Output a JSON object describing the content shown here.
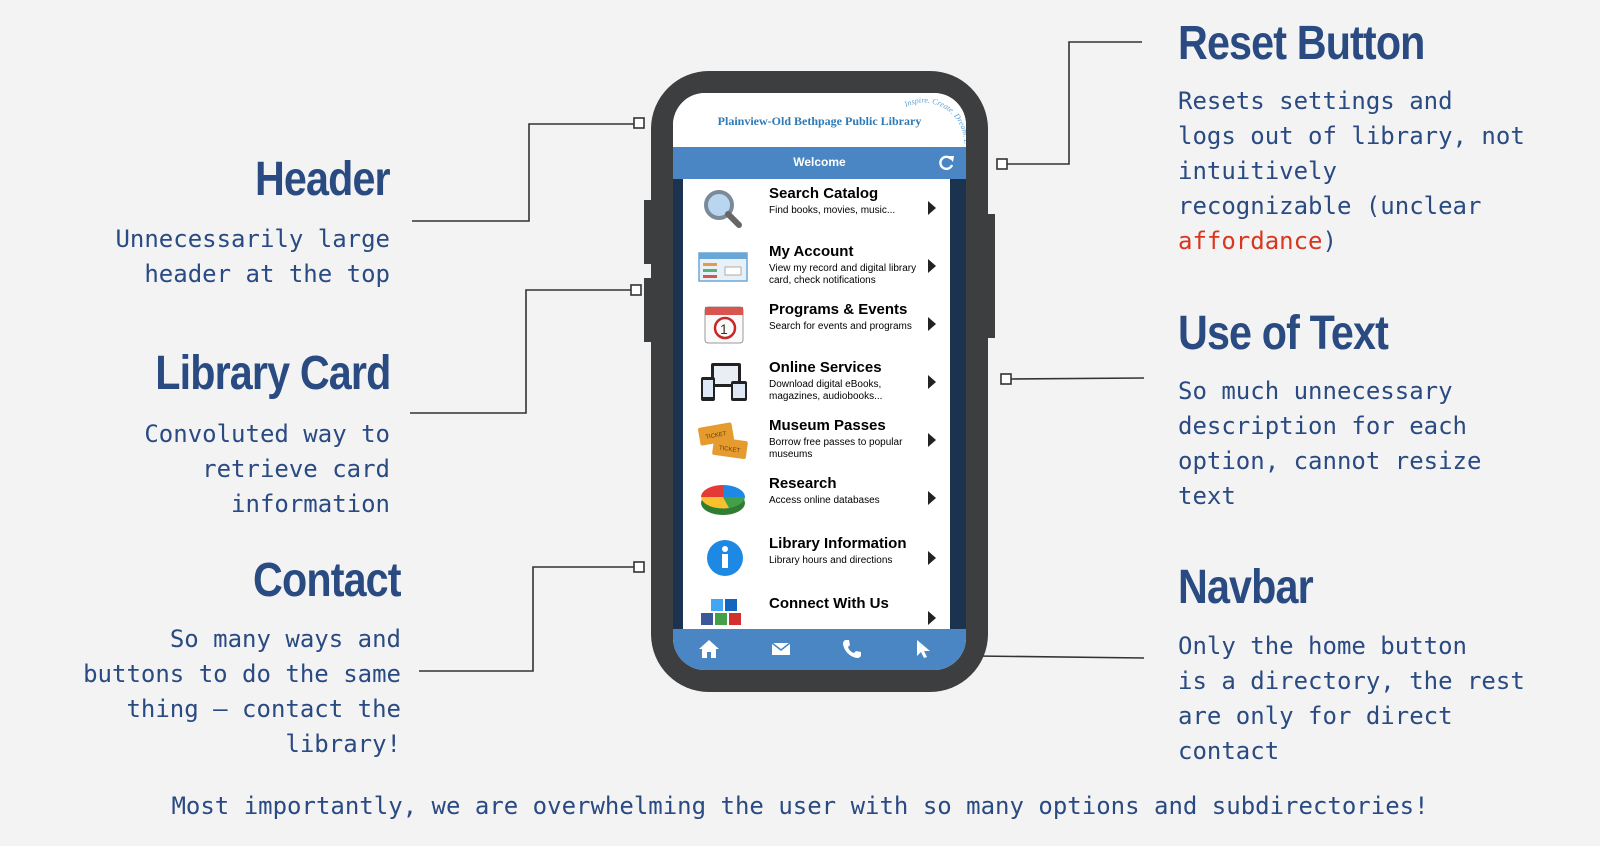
{
  "annotations": {
    "header": {
      "title": "Header",
      "desc_lines": [
        "Unnecessarily large",
        "header at the top"
      ]
    },
    "library_card": {
      "title": "Library Card",
      "desc_lines": [
        "Convoluted way to",
        "retrieve card",
        "information"
      ]
    },
    "contact": {
      "title": "Contact",
      "desc_lines": [
        "So many ways and",
        "buttons to do the same",
        "thing — contact the",
        "library!"
      ]
    },
    "reset_button": {
      "title": "Reset Button",
      "desc_lines": [
        "Resets settings and",
        "logs out of library, not",
        "intuitively",
        "recognizable (unclear"
      ],
      "desc_highlight": "affordance",
      "desc_end": ")"
    },
    "use_of_text": {
      "title": "Use of Text",
      "desc_lines": [
        "So much unnecessary",
        "description for each",
        "option, cannot resize",
        "text"
      ]
    },
    "navbar": {
      "title": "Navbar",
      "desc_lines": [
        "Only the home button",
        "is a directory, the rest",
        "are only for direct",
        "contact"
      ]
    }
  },
  "footer": "Most importantly, we are overwhelming the user with so many options and subdirectories!",
  "phone": {
    "header_title": "Plainview-Old Bethpage Public Library",
    "header_tagline": "Inspire. Create. Dream. Learn.",
    "welcome": "Welcome",
    "menu": [
      {
        "title": "Search Catalog",
        "subtitle": "Find books, movies, music...",
        "icon": "magnifier-icon"
      },
      {
        "title": "My Account",
        "subtitle": "View my record and digital library card, check notifications",
        "icon": "library-card-icon"
      },
      {
        "title": "Programs & Events",
        "subtitle": "Search for events and programs",
        "icon": "calendar-icon"
      },
      {
        "title": "Online Services",
        "subtitle": "Download digital eBooks, magazines, audiobooks...",
        "icon": "devices-icon"
      },
      {
        "title": "Museum Passes",
        "subtitle": "Borrow free passes to popular museums",
        "icon": "ticket-icon"
      },
      {
        "title": "Research",
        "subtitle": "Access online databases",
        "icon": "pie-chart-icon"
      },
      {
        "title": "Library Information",
        "subtitle": "Library hours and directions",
        "icon": "info-icon"
      },
      {
        "title": "Connect With Us",
        "subtitle": "",
        "icon": "social-icons"
      }
    ],
    "navbar": [
      "home-icon",
      "mail-icon",
      "phone-icon",
      "cursor-icon"
    ]
  },
  "colors": {
    "title": "#2a4a82",
    "accent_red": "#d9361f",
    "app_blue": "#4a86c4",
    "phone_body": "#3d3e40"
  }
}
